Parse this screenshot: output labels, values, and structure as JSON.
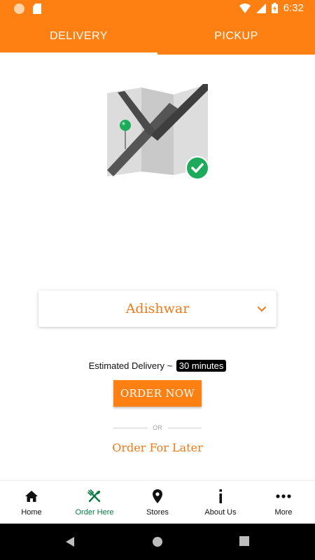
{
  "status_bar": {
    "time": "6:32"
  },
  "tabs": [
    {
      "label": "DELIVERY",
      "active": true
    },
    {
      "label": "PICKUP",
      "active": false
    }
  ],
  "outlet_select": {
    "selected": "Adishwar"
  },
  "estimate": {
    "label": "Estimated Delivery ~",
    "value": "30 minutes"
  },
  "order_now_label": "ORDER NOW",
  "or_label": "OR",
  "order_later_label": "Order For Later",
  "bottom_nav": [
    {
      "label": "Home",
      "icon": "home-icon"
    },
    {
      "label": "Order Here",
      "icon": "fork-knife-icon",
      "active": true
    },
    {
      "label": "Stores",
      "icon": "location-pin-icon"
    },
    {
      "label": "About Us",
      "icon": "info-icon"
    },
    {
      "label": "More",
      "icon": "more-dots-icon"
    }
  ],
  "colors": {
    "accent": "#ff8012",
    "accent_text": "#ef7a1a",
    "active_nav": "#0a7a43",
    "check_green": "#1eaa5b"
  }
}
